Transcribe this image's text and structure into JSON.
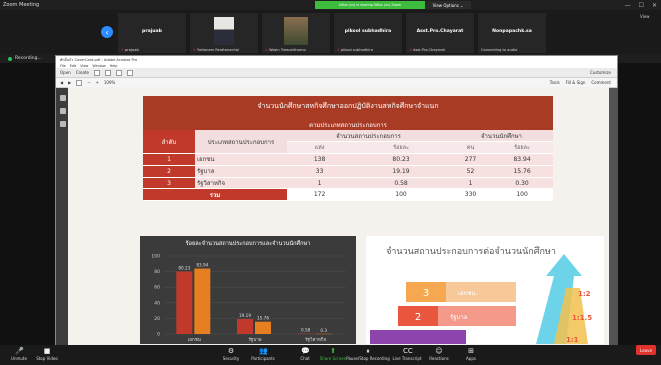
{
  "window": {
    "title": "Zoom Meeting"
  },
  "banner": {
    "text": "Sitha (กก) is sharing Sitha (กก) Zoom"
  },
  "view_options": {
    "label": "View Options ⌄"
  },
  "view_label": "View",
  "participants": [
    {
      "name": "prajuab",
      "sub": "prajuab"
    },
    {
      "name": "",
      "sub": "Yuttanam Reattanachai"
    },
    {
      "name": "",
      "sub": "Wasin Treecatthorno"
    },
    {
      "name": "pikool subhadhira",
      "sub": "pikool subhadhira"
    },
    {
      "name": "Asst.Pro.Chayarat",
      "sub": "Asst.Pro.Chayarat"
    },
    {
      "name": "Nonpapachk.sa",
      "sub": "Connecting to audio"
    }
  ],
  "recording": {
    "label": "Recording..."
  },
  "acrobat": {
    "title": "ศักดิ์แก้ว CoverCard.pdf - Adobe Acrobat Pro",
    "menu": [
      "File",
      "Edit",
      "View",
      "Window",
      "Help"
    ],
    "toolbar1": [
      "Open",
      "Create"
    ],
    "toolbar1_right": "Customize",
    "toolbar2_zoom": "109%",
    "toolbar2_right": [
      "Tools",
      "Fill & Sign",
      "Comment"
    ]
  },
  "slide": {
    "header_line1": "จำนวนนักศึกษาสหกิจศึกษาออกปฏิบัติงานสหกิจศึกษาจำแนก",
    "header_line2": "ตามประเภทสถานประกอบการ",
    "col_rank": "ลำดับ",
    "col_type": "ประเภทสถานประกอบการ",
    "col_place": "จำนวนสถานประกอบการ",
    "col_student": "จำนวนนักศึกษา",
    "sub1": "แห่ง",
    "sub2": "ร้อยละ",
    "sub3": "คน",
    "sub4": "ร้อยละ",
    "rows": [
      {
        "rank": "1",
        "type": "เอกชน",
        "a": "138",
        "b": "80.23",
        "c": "277",
        "d": "83.94"
      },
      {
        "rank": "2",
        "type": "รัฐบาล",
        "a": "33",
        "b": "19.19",
        "c": "52",
        "d": "15.76"
      },
      {
        "rank": "3",
        "type": "รัฐวิสาหกิจ",
        "a": "1",
        "b": "0.58",
        "c": "1",
        "d": "0.30"
      }
    ],
    "total": {
      "label": "รวม",
      "a": "172",
      "b": "100",
      "c": "330",
      "d": "100"
    },
    "chart_title": "ร้อยละจำนวนสถานประกอบการและจำนวนนักศึกษา",
    "info_title": "จำนวนสถานประกอบการต่อจำนวนนักศึกษา",
    "info_rows": [
      {
        "num": "3",
        "label": "เอกชน",
        "ratio": "1:2"
      },
      {
        "num": "2",
        "label": "รัฐบาล",
        "ratio": "1:1.5"
      },
      {
        "num": "",
        "label": "",
        "ratio": "1:1"
      }
    ]
  },
  "chart_data": {
    "type": "bar",
    "title": "ร้อยละจำนวนสถานประกอบการและจำนวนนักศึกษา",
    "categories": [
      "เอกชน",
      "รัฐบาล",
      "รัฐวิสาหกิจ"
    ],
    "series": [
      {
        "values": [
          80.23,
          19.19,
          0.58
        ],
        "color": "#c0392b"
      },
      {
        "values": [
          83.94,
          15.76,
          0.3
        ],
        "color": "#e67e22"
      }
    ],
    "ylim": [
      0,
      100
    ],
    "yticks": [
      "0",
      "20",
      "40",
      "60",
      "80",
      "100"
    ]
  },
  "zoom_toolbar": [
    {
      "icon": "🎤",
      "label": "Unmute"
    },
    {
      "icon": "■",
      "label": "Stop Video"
    },
    {
      "icon": "⚙",
      "label": "Security"
    },
    {
      "icon": "👥",
      "label": "Participants"
    },
    {
      "icon": "💬",
      "label": "Chat"
    },
    {
      "icon": "⬆",
      "label": "Share Screen"
    },
    {
      "icon": "⏸",
      "label": "Pause/Stop Recording"
    },
    {
      "icon": "CC",
      "label": "Live Transcript"
    },
    {
      "icon": "☺",
      "label": "Reactions"
    },
    {
      "icon": "⊞",
      "label": "Apps"
    }
  ],
  "leave": "Leave",
  "colors": {
    "accent": "#a93a24",
    "zoom_blue": "#2d8cff",
    "green": "#3dbb3d"
  }
}
